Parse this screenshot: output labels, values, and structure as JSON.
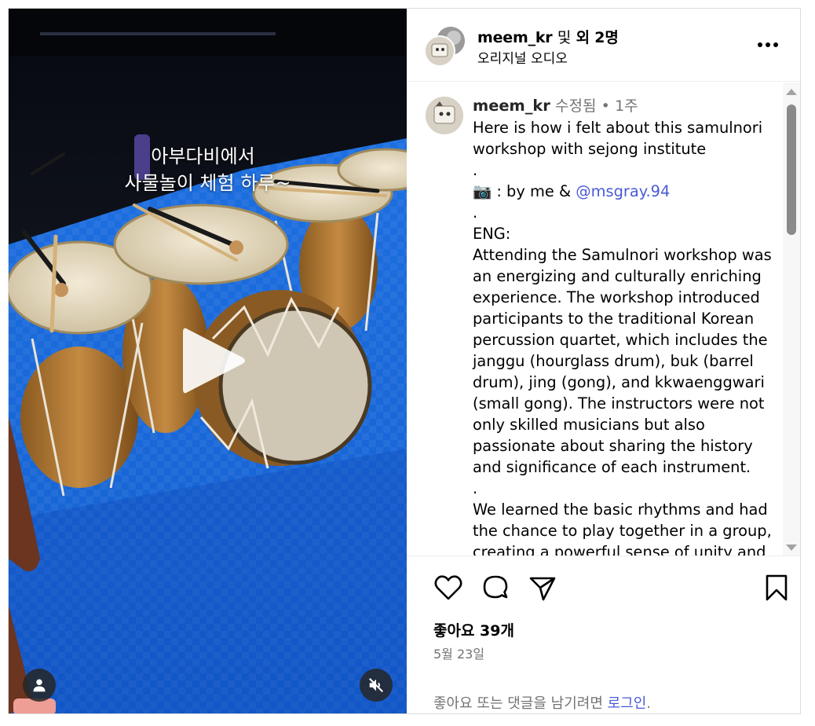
{
  "video": {
    "overlay_line1": "아부다비에서",
    "overlay_line2": "사물놀이 체험 하루~",
    "play_icon": "play-icon",
    "user_icon": "person-icon",
    "mute_icon": "volume-muted-icon"
  },
  "header": {
    "username": "meem_kr",
    "and_text": "및",
    "others_text": "외 2명",
    "audio_label": "오리지널 오디오",
    "more_icon": "more-options-icon"
  },
  "caption": {
    "username": "meem_kr",
    "edited": "수정됨",
    "separator": "•",
    "time_ago": "1주",
    "lines_before_mention": [
      "Here is how i felt about this samulnori",
      "workshop with sejong institute",
      "."
    ],
    "camera_emoji": "📷",
    "credit_prefix": " : by me & ",
    "mention": "@msgray.94",
    "lines_after_mention": [
      ".",
      "ENG:",
      "Attending the Samulnori workshop was",
      "an energizing and culturally enriching",
      "experience. The workshop introduced",
      "participants to the traditional Korean",
      "percussion quartet, which includes the",
      "janggu (hourglass drum), buk (barrel",
      "drum), jing (gong), and kkwaenggwari",
      "(small gong). The instructors were not",
      "only skilled musicians but also",
      "passionate about sharing the history",
      "and significance of each instrument.",
      ".",
      "We learned the basic rhythms and had",
      "the chance to play together in a group,",
      "creating a powerful sense of unity and"
    ]
  },
  "actions": {
    "likes": "좋아요 39개",
    "date": "5월 23일",
    "login_prefix": "좋아요 또는 댓글을 남기려면 ",
    "login_link": "로그인",
    "login_suffix": ".",
    "icons": [
      "heart-icon",
      "comment-icon",
      "share-icon",
      "bookmark-icon"
    ]
  },
  "colors": {
    "accent_link": "#4a5bd6",
    "mat_blue": "#1a66d8",
    "border": "#dbdbdb"
  }
}
